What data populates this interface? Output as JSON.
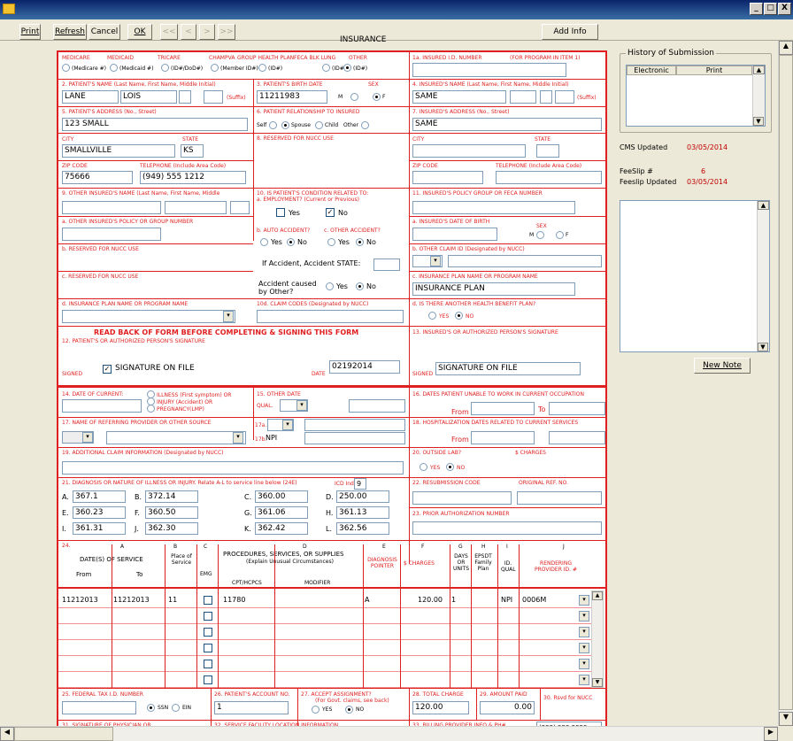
{
  "toolbar": {
    "print": "Print",
    "refresh": "Refresh",
    "cancel": "Cancel",
    "ok": "OK",
    "first": "<<",
    "prev": "<",
    "next": ">",
    "last": ">>",
    "add_info": "Add Info",
    "title": "INSURANCE"
  },
  "win_buttons": [
    "_",
    "□",
    "X"
  ],
  "f1": {
    "medicare": "MEDICARE",
    "medicaid": "MEDICAID",
    "tricare": "TRICARE",
    "champva": "CHAMPVA",
    "ghp": "GROUP HEALTH PLAN",
    "feca": "FECA BLK LUNG",
    "other": "OTHER",
    "o1": "(Medicare #)",
    "o2": "(Medicaid #)",
    "o3": "(ID#/DoD#)",
    "o4": "(Member ID#)",
    "o5": "(ID#)",
    "o6": "(ID#)",
    "o7": "(ID#)"
  },
  "f1a": {
    "label": "1a. INSURED I.D. NUMBER",
    "label2": "(FOR PROGRAM IN ITEM 1)",
    "value": ""
  },
  "f2": {
    "label": "2. PATIENT'S NAME (Last Name, First Name, Middle Initial)",
    "last": "LANE",
    "first": "LOIS",
    "suffix": "(Suffix)"
  },
  "f3": {
    "label": "3. PATIENT'S BIRTH DATE",
    "sex": "SEX",
    "dob": "11211983",
    "m": "M",
    "f": "F"
  },
  "f4": {
    "label": "4. INSURED'S NAME (Last Name, First Name, Middle Initial)",
    "value": "SAME",
    "suffix": "(Suffix)"
  },
  "f5": {
    "label": "5. PATIENT'S ADDRESS (No., Street)",
    "street": "123 SMALL",
    "city_l": "CITY",
    "city": "SMALLVILLE",
    "state_l": "STATE",
    "state": "KS",
    "zip_l": "ZIP CODE",
    "zip": "75666",
    "tel_l": "TELEPHONE (Include Area Code)",
    "tel": "(949) 555 1212"
  },
  "f6": {
    "label": "6. PATIENT RELATIONSHIP TO INSURED",
    "self": "Self",
    "spouse": "Spouse",
    "child": "Child",
    "other": "Other"
  },
  "f7": {
    "label": "7. INSURED'S ADDRESS (No., Street)",
    "street": "SAME",
    "city_l": "CITY",
    "state_l": "STATE",
    "zip_l": "ZIP CODE",
    "tel_l": "TELEPHONE (Include Area Code)"
  },
  "f8": {
    "label": "8. RESERVED FOR NUCC USE"
  },
  "f9": {
    "label": "9. OTHER INSURED'S NAME (Last Name, First Name, Middle",
    "a": "a. OTHER INSURED'S POLICY OR GROUP NUMBER",
    "b": "b. RESERVED FOR NUCC USE",
    "c": "c. RESERVED FOR NUCC USE",
    "d": "d. INSURANCE PLAN NAME OR PROGRAM NAME"
  },
  "f10": {
    "label": "10. IS PATIENT'S CONDITION RELATED TO:",
    "a": "a. EMPLOYMENT? (Current or Previous)",
    "yes": "Yes",
    "no": "No",
    "b": "b. AUTO ACCIDENT?",
    "c": "c. OTHER ACCIDENT?",
    "state": "If Accident, Accident STATE:",
    "caused": "Accident caused by Other?",
    "d": "10d. CLAIM CODES (Designated by NUCC)"
  },
  "f11": {
    "label": "11. INSURED'S POLICY GROUP OR FECA NUMBER",
    "a": "a. INSURED'S DATE OF BIRTH",
    "sex": "SEX",
    "m": "M",
    "f": "F",
    "b": "b. OTHER CLAIM ID (Designated by NUCC)",
    "c": "c. INSURANCE PLAN NAME OR PROGRAM NAME",
    "plan": "INSURANCE PLAN",
    "d": "d. IS THERE ANOTHER HEALTH BENEFIT PLAN?",
    "yes": "YES",
    "no": "NO"
  },
  "f12": {
    "read": "READ BACK OF FORM BEFORE COMPLETING & SIGNING THIS FORM",
    "label": "12. PATIENT'S OR AUTHORIZED PERSON'S SIGNATURE",
    "signed": "SIGNED",
    "sof": "SIGNATURE ON FILE",
    "date_l": "DATE",
    "date": "02192014"
  },
  "f13": {
    "label": "13. INSURED'S OR AUTHORIZED PERSON'S SIGNATURE",
    "signed": "SIGNED",
    "value": "SIGNATURE ON FILE"
  },
  "f14": {
    "label": "14. DATE OF CURRENT:",
    "o1": "ILLNESS (First symptom) OR",
    "o2": "INJURY (Accident) OR",
    "o3": "PREGNANCY(LMP)"
  },
  "f15": {
    "label": "15. OTHER DATE",
    "qual": "QUAL."
  },
  "f16": {
    "label": "16. DATES PATIENT UNABLE TO WORK IN CURRENT OCCUPATION",
    "from": "From",
    "to": "To"
  },
  "f17": {
    "label": "17. NAME OF REFERRING PROVIDER OR OTHER SOURCE",
    "a": "17a.",
    "b": "17b.",
    "npi": "NPI"
  },
  "f18": {
    "label": "18. HOSPITALIZATION DATES RELATED TO CURRENT SERVICES",
    "from": "From",
    "to": "To"
  },
  "f19": {
    "label": "19. ADDITIONAL CLAIM INFORMATION (Designated by NUCC)"
  },
  "f20": {
    "label": "20. OUTSIDE LAB?",
    "charges": "$ CHARGES",
    "yes": "YES",
    "no": "NO"
  },
  "f21": {
    "label": "21. DIAGNOSIS OR NATURE OF ILLNESS OR INJURY. Relate A-L to service line below (24E)",
    "icd_l": "ICD Ind.",
    "icd": "9",
    "codes": [
      [
        "A.",
        "367.1"
      ],
      [
        "B.",
        "372.14"
      ],
      [
        "C.",
        "360.00"
      ],
      [
        "D.",
        "250.00"
      ],
      [
        "E.",
        "360.23"
      ],
      [
        "F.",
        "360.50"
      ],
      [
        "G.",
        "361.06"
      ],
      [
        "H.",
        "361.13"
      ],
      [
        "I.",
        "361.31"
      ],
      [
        "J.",
        "362.30"
      ],
      [
        "K.",
        "362.42"
      ],
      [
        "L.",
        "362.56"
      ]
    ]
  },
  "f22": {
    "label": "22. RESUBMISSION CODE",
    "orig": "ORIGINAL REF. NO."
  },
  "f23": {
    "label": "23. PRIOR AUTHORIZATION NUMBER"
  },
  "f24": {
    "num": "24.",
    "cols": [
      "A",
      "B",
      "C",
      "D",
      "E",
      "F",
      "G",
      "H",
      "I",
      "J"
    ],
    "h_a": "DATE(S) OF SERVICE",
    "from": "From",
    "to": "To",
    "place": "Place of Service",
    "emg": "EMG",
    "proc": "PROCEDURES, SERVICES, OR SUPPLIES",
    "proc2": "(Explain Unusual Circumstances)",
    "cpt": "CPT/HCPCS",
    "mod": "MODIFIER",
    "diag": "DIAGNOSIS POINTER",
    "charges": "$ CHARGES",
    "days": "DAYS OR UNITS",
    "epsdt": "EPSDT Family Plan",
    "idq": "ID. QUAL",
    "rend": "RENDERING PROVIDER ID. #",
    "rows": [
      {
        "from": "11212013",
        "to": "11212013",
        "pos": "11",
        "cpt": "11780",
        "ptr": "A",
        "charges": "120.00",
        "units": "1",
        "qual": "NPI",
        "prov": "0006M"
      },
      {
        "from": "",
        "to": "",
        "pos": "",
        "cpt": "",
        "ptr": "",
        "charges": "",
        "units": "",
        "qual": "",
        "prov": ""
      },
      {
        "from": "",
        "to": "",
        "pos": "",
        "cpt": "",
        "ptr": "",
        "charges": "",
        "units": "",
        "qual": "",
        "prov": ""
      },
      {
        "from": "",
        "to": "",
        "pos": "",
        "cpt": "",
        "ptr": "",
        "charges": "",
        "units": "",
        "qual": "",
        "prov": ""
      },
      {
        "from": "",
        "to": "",
        "pos": "",
        "cpt": "",
        "ptr": "",
        "charges": "",
        "units": "",
        "qual": "",
        "prov": ""
      },
      {
        "from": "",
        "to": "",
        "pos": "",
        "cpt": "",
        "ptr": "",
        "charges": "",
        "units": "",
        "qual": "",
        "prov": ""
      }
    ]
  },
  "f25": {
    "label": "25. FEDERAL TAX I.D. NUMBER",
    "ssn": "SSN",
    "ein": "EIN"
  },
  "f26": {
    "label": "26. PATIENT'S ACCOUNT NO.",
    "value": "1"
  },
  "f27": {
    "label": "27. ACCEPT ASSIGNMENT?",
    "sub": "(For Govt. claims, see back)",
    "yes": "YES",
    "no": "NO"
  },
  "f28": {
    "label": "28. TOTAL CHARGE",
    "value": "120.00"
  },
  "f29": {
    "label": "29. AMOUNT PAID",
    "value": "0.00"
  },
  "f30": {
    "label": "30. Rsvd for NUCC"
  },
  "f31": {
    "label": "31. SIGNATURE OF PHYSICIAN OR"
  },
  "f32": {
    "label": "32. SERVICE FACILITY LOCATION INFORMATION"
  },
  "f33": {
    "label": "33. BILLING PROVIDER INFO & PH#",
    "value": "(999) 999 9999"
  },
  "side": {
    "history": "History of Submission",
    "electronic": "Electronic",
    "print": "Print",
    "cms_l": "CMS Updated",
    "cms": "03/05/2014",
    "fee_l": "FeeSlip #",
    "fee": "6",
    "feeup_l": "Feeslip Updated",
    "feeup": "03/05/2014",
    "new_note": "New Note"
  },
  "colors": {
    "form_red": "#e02020",
    "window": "#ece9d8",
    "accent": "#c00000"
  }
}
